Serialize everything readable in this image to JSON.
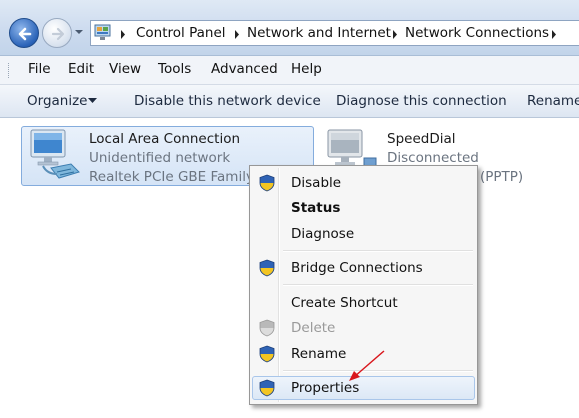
{
  "breadcrumb": {
    "items": [
      "Control Panel",
      "Network and Internet",
      "Network Connections"
    ]
  },
  "menu": {
    "items": [
      "File",
      "Edit",
      "View",
      "Tools",
      "Advanced",
      "Help"
    ]
  },
  "commands": {
    "organize": "Organize",
    "disable": "Disable this network device",
    "diagnose": "Diagnose this connection",
    "rename": "Rename"
  },
  "connections": [
    {
      "name": "Local Area Connection",
      "status": "Unidentified network",
      "device": "Realtek PCIe GBE Family C"
    },
    {
      "name": "SpeedDial",
      "status": "Disconnected",
      "device": "(PPTP)"
    }
  ],
  "context_menu": {
    "items": [
      "Disable",
      "Status",
      "Diagnose",
      "Bridge Connections",
      "Create Shortcut",
      "Delete",
      "Rename",
      "Properties"
    ]
  },
  "colors": {
    "accent": "#2a63b8",
    "selection_bg": "#d5e4f6",
    "annotation_arrow": "#d9161c"
  }
}
